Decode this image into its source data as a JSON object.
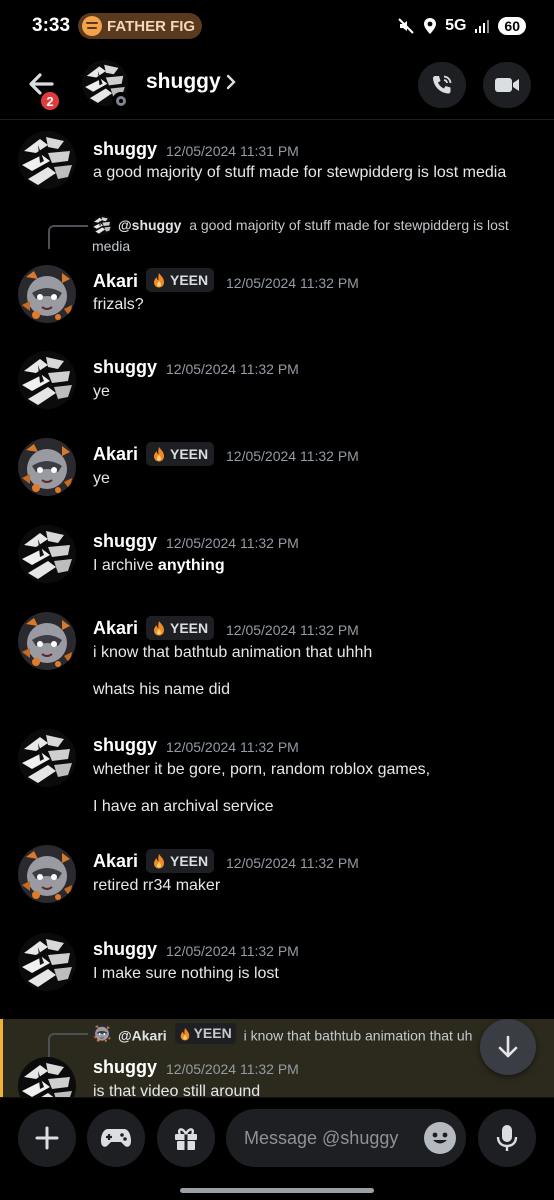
{
  "status_bar": {
    "time": "3:33",
    "media": "FATHER FIG",
    "network": "5G",
    "battery": "60"
  },
  "header": {
    "name": "shuggy",
    "back_badge": "2"
  },
  "messages": [
    {
      "user": "shuggy",
      "time": "12/05/2024 11:31 PM",
      "lines": [
        "a good majority of stuff made for stewpidderg is lost media"
      ]
    },
    {
      "user": "Akari",
      "tag": "YEEN",
      "time": "12/05/2024 11:32 PM",
      "reply": {
        "user": "@shuggy",
        "text": "a good majority of stuff made for stewpidderg is lost media"
      },
      "lines": [
        "frizals?"
      ]
    },
    {
      "user": "shuggy",
      "time": "12/05/2024 11:32 PM",
      "lines": [
        "ye"
      ]
    },
    {
      "user": "Akari",
      "tag": "YEEN",
      "time": "12/05/2024 11:32 PM",
      "lines": [
        "ye"
      ]
    },
    {
      "user": "shuggy",
      "time": "12/05/2024 11:32 PM",
      "line_prefix": "I archive ",
      "line_bold": "anything"
    },
    {
      "user": "Akari",
      "tag": "YEEN",
      "time": "12/05/2024 11:32 PM",
      "lines": [
        "i know that bathtub animation that uhhh",
        "whats his name did"
      ]
    },
    {
      "user": "shuggy",
      "time": "12/05/2024 11:32 PM",
      "lines": [
        "whether it be gore, porn, random roblox games,",
        "I have an archival service"
      ]
    },
    {
      "user": "Akari",
      "tag": "YEEN",
      "time": "12/05/2024 11:32 PM",
      "lines": [
        "retired rr34 maker"
      ]
    },
    {
      "user": "shuggy",
      "time": "12/05/2024 11:32 PM",
      "lines": [
        "I make sure nothing is lost"
      ]
    },
    {
      "user": "shuggy",
      "time": "12/05/2024 11:32 PM",
      "reply": {
        "user": "@Akari",
        "tag": "YEEN",
        "text": "i know that bathtub animation that uh"
      },
      "lines": [
        "is that video still around"
      ]
    }
  ],
  "composer": {
    "placeholder": "Message @shuggy"
  },
  "colors": {
    "background": "#000000",
    "reply_highlight": "#2c2a1c",
    "mention_bar": "#f0b232",
    "badge_red": "#e03a3e"
  }
}
